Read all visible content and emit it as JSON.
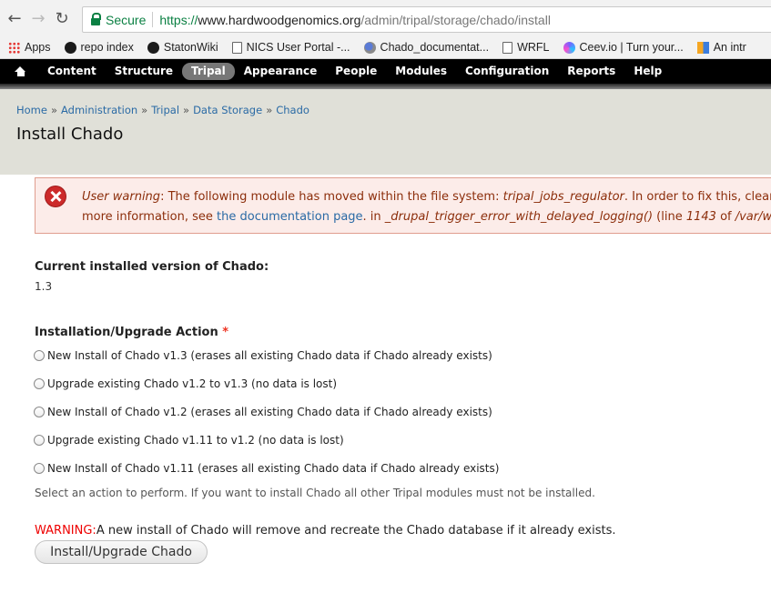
{
  "browser": {
    "secure_label": "Secure",
    "url_proto": "https://",
    "url_host": "www.hardwoodgenomics.org",
    "url_path": "/admin/tripal/storage/chado/install"
  },
  "bookmarks": [
    {
      "label": "Apps",
      "icon": "apps-grid-icon"
    },
    {
      "label": "repo index",
      "icon": "github-icon"
    },
    {
      "label": "StatonWiki",
      "icon": "github-icon"
    },
    {
      "label": "NICS User Portal -...",
      "icon": "page-icon"
    },
    {
      "label": "Chado_documentat...",
      "icon": "chado-icon"
    },
    {
      "label": "WRFL",
      "icon": "page-icon"
    },
    {
      "label": "Ceev.io | Turn your...",
      "icon": "ceev-icon"
    },
    {
      "label": "An intr",
      "icon": "intro-icon"
    }
  ],
  "toolbar": {
    "items": [
      {
        "label": "Content",
        "active": false
      },
      {
        "label": "Structure",
        "active": false
      },
      {
        "label": "Tripal",
        "active": true
      },
      {
        "label": "Appearance",
        "active": false
      },
      {
        "label": "People",
        "active": false
      },
      {
        "label": "Modules",
        "active": false
      },
      {
        "label": "Configuration",
        "active": false
      },
      {
        "label": "Reports",
        "active": false
      },
      {
        "label": "Help",
        "active": false
      }
    ]
  },
  "breadcrumb": [
    "Home",
    "Administration",
    "Tripal",
    "Data Storage",
    "Chado"
  ],
  "page_title": "Install Chado",
  "message": {
    "type_label": "User warning",
    "text1": ": The following module has moved within the file system: ",
    "module": "tripal_jobs_regulator",
    "text2": ". In order to fix this, clear ca",
    "text3": "more information, see ",
    "link": "the documentation page",
    "text4": ". in ",
    "func": "_drupal_trigger_error_with_delayed_logging()",
    "text5": " (line ",
    "line_no": "1143",
    "text6": " of ",
    "path": "/var/www"
  },
  "current_version": {
    "label": "Current installed version of Chado:",
    "value": "1.3"
  },
  "action": {
    "label": "Installation/Upgrade Action",
    "required_marker": "*",
    "options": [
      "New Install of Chado v1.3 (erases all existing Chado data if Chado already exists)",
      "Upgrade existing Chado v1.2 to v1.3 (no data is lost)",
      "New Install of Chado v1.2 (erases all existing Chado data if Chado already exists)",
      "Upgrade existing Chado v1.11 to v1.2 (no data is lost)",
      "New Install of Chado v1.11 (erases all existing Chado data if Chado already exists)"
    ],
    "description": "Select an action to perform. If you want to install Chado all other Tripal modules must not be installed."
  },
  "warning": {
    "prefix": "WARNING:",
    "text": "A new install of Chado will remove and recreate the Chado database if it already exists."
  },
  "submit_label": "Install/Upgrade Chado"
}
